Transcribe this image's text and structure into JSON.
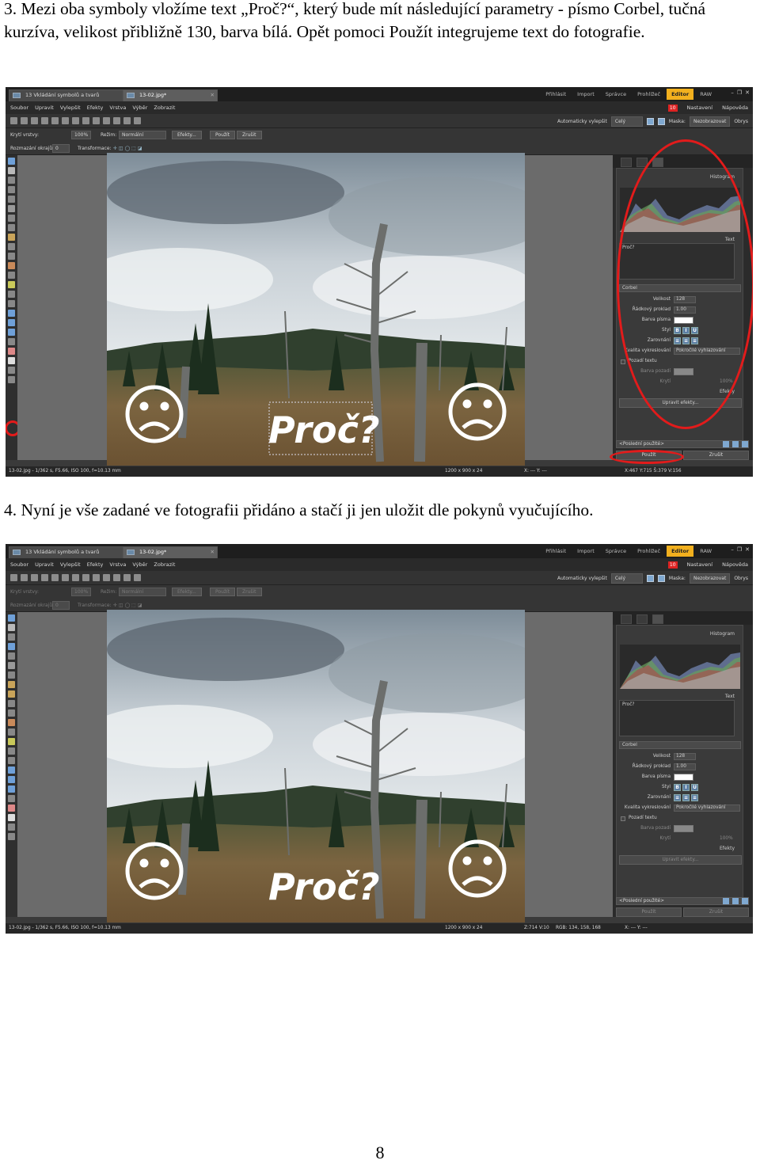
{
  "step3": {
    "text": "3. Mezi oba symboly vložíme text „Proč?“, který bude mít následující parametry - písmo Corbel, tučná kurzíva, velikost přibližně 130, barva bílá. Opět pomoci Použít integrujeme text do fotografie."
  },
  "step4": {
    "text": "4. Nyní je vše zadané ve fotografii přidáno a stačí ji jen uložit dle pokynů vyučujícího."
  },
  "page_number": "8",
  "screenshot1": {
    "tab1": "13 Vkládání symbolů a tvarů",
    "tab2": "13-02.jpg*",
    "modes": [
      "Přihlásit",
      "Import",
      "Správce",
      "Prohlížeč",
      "Editor",
      "RAW"
    ],
    "active_mode": "Editor",
    "menu": [
      "Soubor",
      "Upravit",
      "Vylepšit",
      "Efekty",
      "Vrstva",
      "Výběr",
      "Zobrazit"
    ],
    "menu_right": [
      "Nastavení",
      "Nápověda"
    ],
    "badge": "10",
    "toolbar_right": {
      "auto": "Automaticky vylepšit",
      "view": "Celý",
      "mask_label": "Maska:",
      "mask_value": "Nezobrazovat",
      "outline": "Obrys"
    },
    "opt1": {
      "opacity_label": "Krytí vrstvy:",
      "opacity_value": "100%",
      "mode_label": "Režim:",
      "mode_value": "Normální",
      "effects": "Efekty...",
      "apply": "Použít",
      "cancel": "Zrušit"
    },
    "opt2": {
      "smooth_label": "Rozmazání okrajů:",
      "smooth_value": "0",
      "transform_label": "Transformace:"
    },
    "canvas_text": "Proč?",
    "panel": {
      "histogram": "Histogram",
      "text_section": "Text",
      "text_content": "Proč?",
      "font": "Corbel",
      "size_label": "Velikost",
      "size_value": "128",
      "leading_label": "Řádkový proklad",
      "leading_value": "1.00",
      "color_label": "Barva písma",
      "style_label": "Styl",
      "align_label": "Zarovnání",
      "quality_label": "Kvalita vykreslování",
      "quality_value": "Pokročilé vyhlazování",
      "bg_label": "Pozadí textu",
      "bgcolor_label": "Barva pozadí",
      "opacity_label": "Krytí",
      "opacity_value": "100%",
      "effects_label": "Efekty",
      "effects_button": "Upravit efekty...",
      "recent": "<Poslední použité>",
      "apply": "Použít",
      "cancel": "Zrušit",
      "text_color": "#ffffff"
    },
    "status": {
      "file": "13-02.jpg - 1/362 s, F5.66, ISO 100, f=10.13 mm",
      "size": "1200 x 900 x 24",
      "xy": "X: --- Y: ---",
      "coords": "X:467 Y:715 Š:379 V:156"
    }
  },
  "screenshot2": {
    "tab1": "13 Vkládání symbolů a tvarů",
    "tab2": "13-02.jpg*",
    "modes": [
      "Přihlásit",
      "Import",
      "Správce",
      "Prohlížeč",
      "Editor",
      "RAW"
    ],
    "active_mode": "Editor",
    "menu": [
      "Soubor",
      "Upravit",
      "Vylepšit",
      "Efekty",
      "Vrstva",
      "Výběr",
      "Zobrazit"
    ],
    "menu_right": [
      "Nastavení",
      "Nápověda"
    ],
    "badge": "10",
    "toolbar_right": {
      "auto": "Automaticky vylepšit",
      "view": "Celý",
      "mask_label": "Maska:",
      "mask_value": "Nezobrazovat",
      "outline": "Obrys"
    },
    "opt1": {
      "opacity_label": "Krytí vrstvy:",
      "opacity_value": "100%",
      "mode_label": "Režim:",
      "mode_value": "Normální",
      "effects": "Efekty...",
      "apply": "Použít",
      "cancel": "Zrušit"
    },
    "opt2": {
      "smooth_label": "Rozmazání okrajů:",
      "smooth_value": "0",
      "transform_label": "Transformace:"
    },
    "canvas_text": "Proč?",
    "panel": {
      "histogram": "Histogram",
      "text_section": "Text",
      "text_content": "Proč?",
      "font": "Corbel",
      "size_label": "Velikost",
      "size_value": "128",
      "leading_label": "Řádkový proklad",
      "leading_value": "1.00",
      "color_label": "Barva písma",
      "style_label": "Styl",
      "align_label": "Zarovnání",
      "quality_label": "Kvalita vykreslování",
      "quality_value": "Pokročilé vyhlazování",
      "bg_label": "Pozadí textu",
      "bgcolor_label": "Barva pozadí",
      "opacity_label": "Krytí",
      "opacity_value": "100%",
      "effects_label": "Efekty",
      "effects_button": "Upravit efekty...",
      "recent": "<Poslední použité>",
      "apply": "Použít",
      "cancel": "Zrušit",
      "text_color": "#ffffff"
    },
    "status": {
      "file": "13-02.jpg - 1/362 s, F5.66, ISO 100, f=10.13 mm",
      "size": "1200 x 900 x 24",
      "xy": "X: --- Y: ---",
      "coords": "Z:714 V:10",
      "rgb": "RGB: 134, 158, 168"
    }
  },
  "colors": {
    "accent": "#f2b01e",
    "highlight": "#e21b1b",
    "panel_bg": "#3a3a3a"
  }
}
